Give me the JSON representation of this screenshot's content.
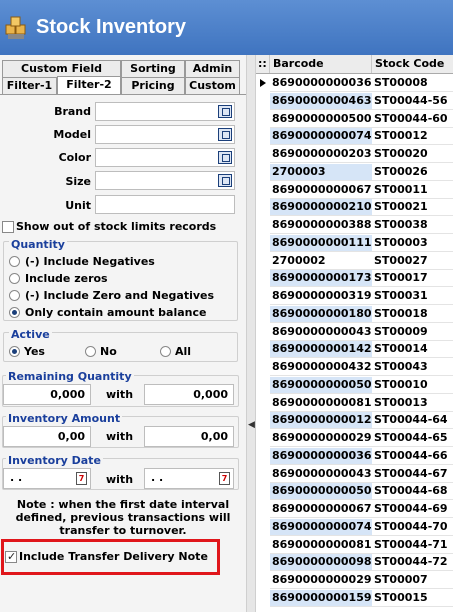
{
  "app": {
    "title": "Stock Inventory"
  },
  "tabs_top": [
    "Custom Field Filter",
    "Sorting",
    "Admin"
  ],
  "tabs_bottom": [
    "Filter-1",
    "Filter-2",
    "Pricing",
    "Custom"
  ],
  "filters": {
    "brand_label": "Brand",
    "model_label": "Model",
    "color_label": "Color",
    "size_label": "Size",
    "unit_label": "Unit"
  },
  "out_of_stock_label": "Show out of stock limits records",
  "quantity": {
    "title": "Quantity",
    "options": [
      "(-) Include Negatives",
      "Include zeros",
      "(-) Include Zero and Negatives",
      "Only contain amount balance"
    ],
    "selected_index": 3
  },
  "active": {
    "title": "Active",
    "options": [
      "Yes",
      "No",
      "All"
    ],
    "selected_index": 0
  },
  "remaining_quantity": {
    "title": "Remaining Quantity",
    "from": "0,000",
    "with_label": "with",
    "to": "0,000"
  },
  "inventory_amount": {
    "title": "Inventory Amount",
    "from": "0,00",
    "with_label": "with",
    "to": "0,00"
  },
  "inventory_date": {
    "title": "Inventory Date",
    "from": ". .",
    "with_label": "with",
    "to": ". .",
    "calendar_glyph": "7"
  },
  "note": "Note : when the first date interval defined, previous transactions will transfer to turnover.",
  "include_transfer": {
    "label": "Include Transfer Delivery Note",
    "checked": true
  },
  "grid": {
    "handle": "::",
    "columns": [
      "Barcode",
      "Stock Code"
    ],
    "rows": [
      [
        "8690000000036",
        "ST00008"
      ],
      [
        "8690000000463",
        "ST00044-56"
      ],
      [
        "8690000000500",
        "ST00044-60"
      ],
      [
        "8690000000074",
        "ST00012"
      ],
      [
        "8690000000203",
        "ST00020"
      ],
      [
        "2700003",
        "ST00026"
      ],
      [
        "8690000000067",
        "ST00011"
      ],
      [
        "8690000000210",
        "ST00021"
      ],
      [
        "8690000000388",
        "ST00038"
      ],
      [
        "8690000000111",
        "ST00003"
      ],
      [
        "2700002",
        "ST00027"
      ],
      [
        "8690000000173",
        "ST00017"
      ],
      [
        "8690000000319",
        "ST00031"
      ],
      [
        "8690000000180",
        "ST00018"
      ],
      [
        "8690000000043",
        "ST00009"
      ],
      [
        "8690000000142",
        "ST00014"
      ],
      [
        "8690000000432",
        "ST00043"
      ],
      [
        "8690000000050",
        "ST00010"
      ],
      [
        "8690000000081",
        "ST00013"
      ],
      [
        "8690000000012",
        "ST00044-64"
      ],
      [
        "8690000000029",
        "ST00044-65"
      ],
      [
        "8690000000036",
        "ST00044-66"
      ],
      [
        "8690000000043",
        "ST00044-67"
      ],
      [
        "8690000000050",
        "ST00044-68"
      ],
      [
        "8690000000067",
        "ST00044-69"
      ],
      [
        "8690000000074",
        "ST00044-70"
      ],
      [
        "8690000000081",
        "ST00044-71"
      ],
      [
        "8690000000098",
        "ST00044-72"
      ],
      [
        "8690000000029",
        "ST00007"
      ],
      [
        "8690000000159",
        "ST00015"
      ]
    ]
  },
  "colors": {
    "title_bar": "#4a80c9",
    "group_title": "#1a3f9c",
    "row_alt": "#d6e5f7",
    "highlight": "#e0161b"
  }
}
